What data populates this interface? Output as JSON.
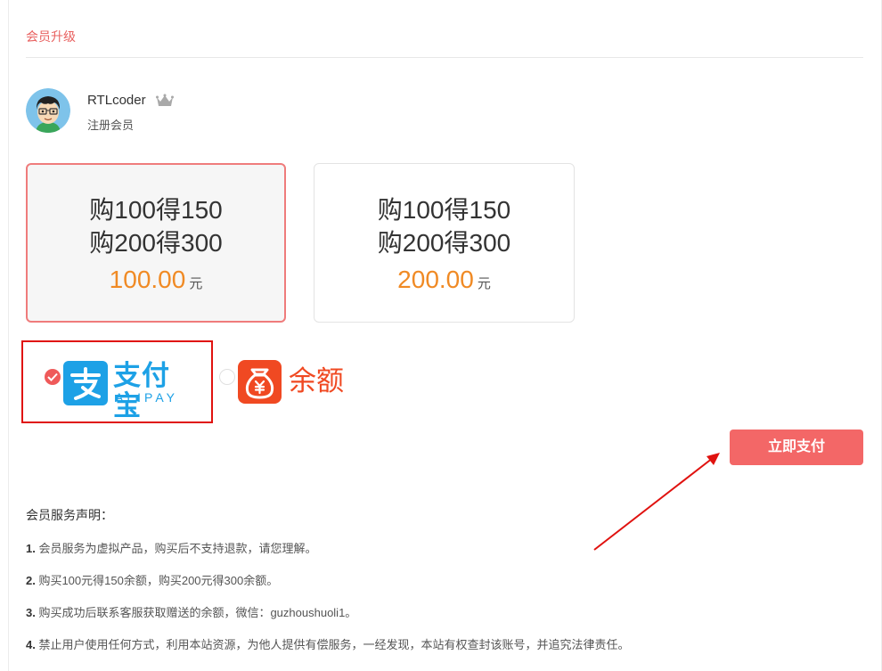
{
  "page": {
    "title": "会员升级"
  },
  "user": {
    "name": "RTLcoder",
    "level": "注册会员"
  },
  "plans": [
    {
      "line1": "购100得150",
      "line2": "购200得300",
      "price": "100.00",
      "unit": "元",
      "selected": true
    },
    {
      "line1": "购100得150",
      "line2": "购200得300",
      "price": "200.00",
      "unit": "元",
      "selected": false
    }
  ],
  "payment": {
    "alipay": {
      "name": "支付宝",
      "sub": "ALIPAY",
      "icon": "alipay-logo-icon",
      "selected": true
    },
    "balance": {
      "name": "余额",
      "icon": "money-bag-icon",
      "selected": false
    }
  },
  "pay_button": "立即支付",
  "notice": {
    "title": "会员服务声明：",
    "items": [
      {
        "num": "1.",
        "text": " 会员服务为虚拟产品，购买后不支持退款，请您理解。"
      },
      {
        "num": "2.",
        "text": " 购买100元得150余额，购买200元得300余额。"
      },
      {
        "num": "3.",
        "text": " 购买成功后联系客服获取赠送的余额，微信：guzhoushuoli1。"
      },
      {
        "num": "4.",
        "text": " 禁止用户使用任何方式，利用本站资源，为他人提供有偿服务，一经发现，本站有权查封该账号，并追究法律责任。"
      }
    ]
  },
  "colors": {
    "accent": "#f36767",
    "title": "#e8605f",
    "price": "#f08a24",
    "alipay": "#1da1e6",
    "balance": "#f04922",
    "highlight": "#e0120f"
  }
}
